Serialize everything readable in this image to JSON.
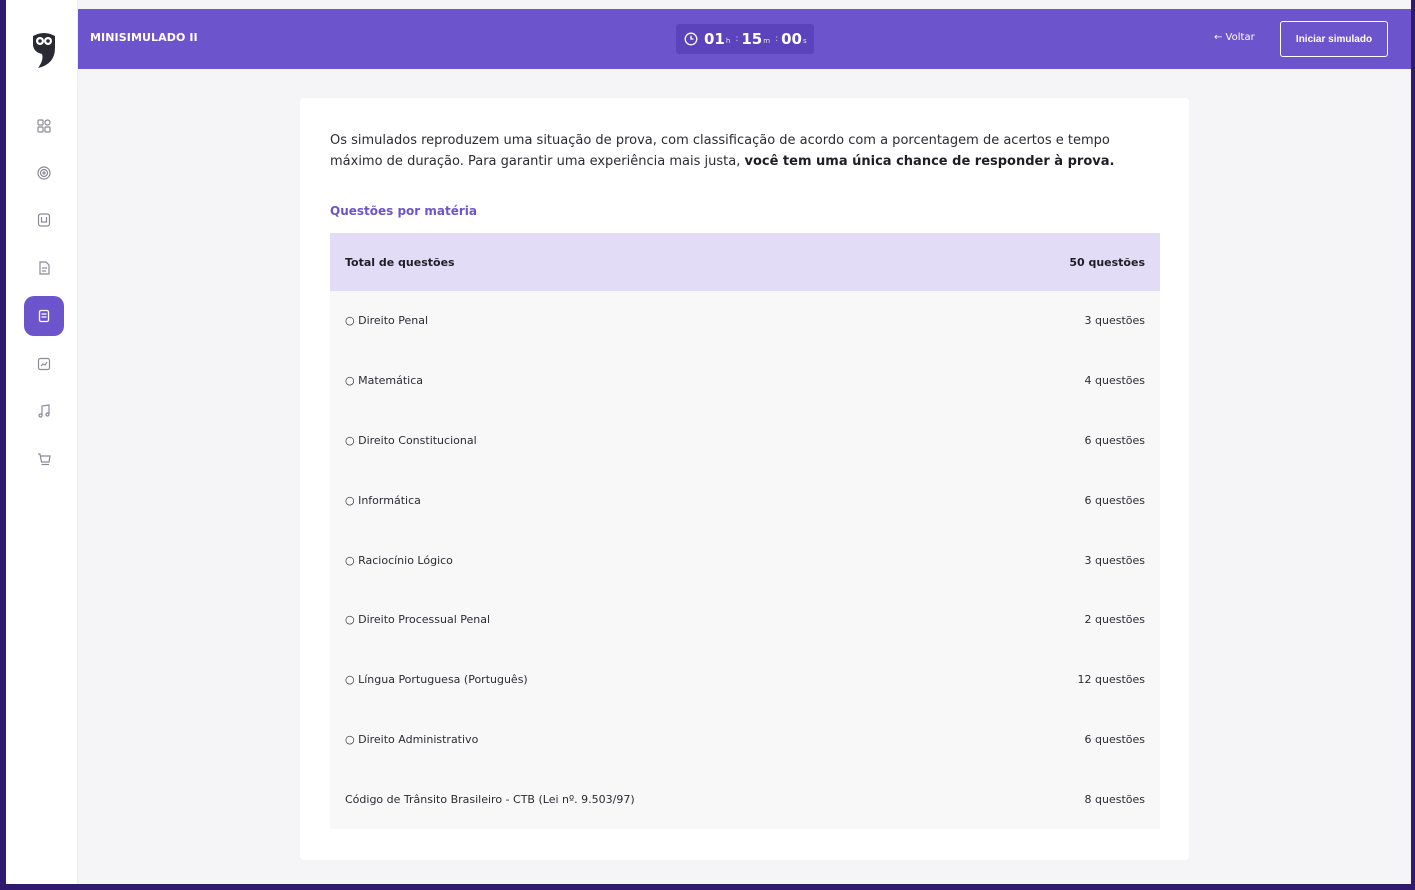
{
  "header": {
    "title": "MINISIMULADO II",
    "timer": {
      "hours": "01",
      "hours_unit": "h",
      "minutes": "15",
      "minutes_unit": "m",
      "seconds": "00",
      "seconds_unit": "s"
    },
    "back_label": "← Voltar",
    "start_label": "Iniciar simulado"
  },
  "sidebar": {
    "items": [
      {
        "icon": "dashboard-icon",
        "active": false
      },
      {
        "icon": "target-icon",
        "active": false
      },
      {
        "icon": "book-icon",
        "active": false
      },
      {
        "icon": "document-icon",
        "active": false
      },
      {
        "icon": "exam-icon",
        "active": true
      },
      {
        "icon": "chart-icon",
        "active": false
      },
      {
        "icon": "music-icon",
        "active": false
      },
      {
        "icon": "cart-icon",
        "active": false
      }
    ]
  },
  "content": {
    "intro_text": "Os simulados reproduzem uma situação de prova, com classificação de acordo com a porcentagem de acertos e tempo máximo de duração. Para garantir uma experiência mais justa,",
    "intro_bold": "você tem uma única chance de responder à prova.",
    "section_title": "Questões por matéria",
    "total_label": "Total de questões",
    "total_value": "50 questões",
    "subjects": [
      {
        "name": "○ Direito Penal",
        "count": "3 questões"
      },
      {
        "name": "○ Matemática",
        "count": "4 questões"
      },
      {
        "name": "○ Direito Constitucional",
        "count": "6 questões"
      },
      {
        "name": "○ Informática",
        "count": "6 questões"
      },
      {
        "name": "○ Raciocínio Lógico",
        "count": "3 questões"
      },
      {
        "name": "○ Direito Processual Penal",
        "count": "2 questões"
      },
      {
        "name": "○ Língua Portuguesa (Português)",
        "count": "12 questões"
      },
      {
        "name": "○ Direito Administrativo",
        "count": "6 questões"
      },
      {
        "name": "Código de Trânsito Brasileiro - CTB (Lei nº. 9.503/97)",
        "count": "8 questões"
      }
    ]
  },
  "colors": {
    "accent": "#6c55cc",
    "header_row": "#e2dcf7",
    "row_bg": "#f8f8f9"
  }
}
